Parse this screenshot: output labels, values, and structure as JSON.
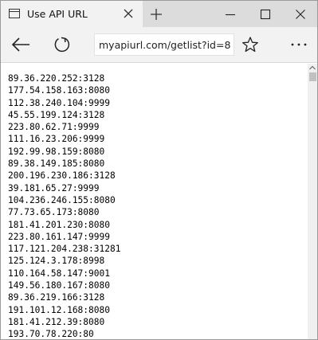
{
  "tab": {
    "title": "Use API URL",
    "icon": "page-icon"
  },
  "window_controls": [
    "minimize-icon",
    "maximize-icon",
    "close-icon"
  ],
  "toolbar": {
    "address": "myapiurl.com/getlist?id=8",
    "icons": [
      "back-arrow-icon",
      "refresh-icon",
      "reading-view-icon",
      "favorite-star-icon",
      "more-icon"
    ]
  },
  "content": {
    "lines": [
      "89.36.220.252:3128",
      "177.54.158.163:8080",
      "112.38.240.104:9999",
      "45.55.199.124:3128",
      "223.80.62.71:9999",
      "111.16.23.206:9999",
      "192.99.98.159:8080",
      "89.38.149.185:8080",
      "200.196.230.186:3128",
      "39.181.65.27:9999",
      "104.236.246.155:8080",
      "77.73.65.173:8080",
      "181.41.201.230:8080",
      "223.80.161.147:9999",
      "117.121.204.238:31281",
      "125.124.3.178:8998",
      "110.164.58.147:9001",
      "149.56.180.167:8080",
      "89.36.219.166:3128",
      "191.101.12.168:8080",
      "181.41.212.39:8080",
      "193.70.78.220:80"
    ]
  },
  "colors": {
    "tabstrip": "#dcdcdc",
    "active_tab": "#f2f2f2",
    "toolbar": "#f2f2f2",
    "scrollbar_thumb": "#c1c1c1"
  }
}
